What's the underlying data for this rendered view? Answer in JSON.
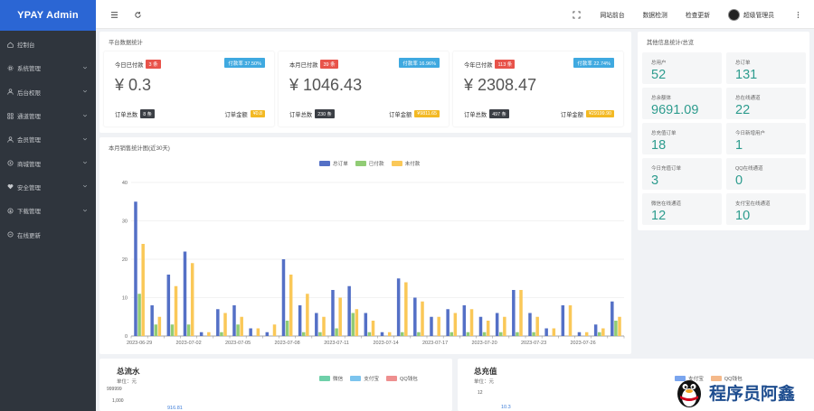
{
  "app": {
    "title": "YPAY Admin"
  },
  "sidebar": {
    "items": [
      {
        "label": "控制台",
        "icon": "home-icon",
        "chevron": false
      },
      {
        "label": "系统管理",
        "icon": "gear-icon",
        "chevron": true
      },
      {
        "label": "后台权限",
        "icon": "user-icon",
        "chevron": true
      },
      {
        "label": "通道管理",
        "icon": "grid-icon",
        "chevron": true
      },
      {
        "label": "会员管理",
        "icon": "user-icon",
        "chevron": true
      },
      {
        "label": "商城管理",
        "icon": "shop-icon",
        "chevron": true
      },
      {
        "label": "安全管理",
        "icon": "heart-icon",
        "chevron": true
      },
      {
        "label": "下载管理",
        "icon": "download-icon",
        "chevron": true
      },
      {
        "label": "在线更新",
        "icon": "refresh-icon",
        "chevron": false
      }
    ]
  },
  "header": {
    "links": [
      "网站前台",
      "数据检测",
      "检查更新"
    ],
    "user": "超级管理员"
  },
  "stats": {
    "title": "平台数据统计",
    "cards": [
      {
        "label": "今日已付款",
        "count_badge": "3 条",
        "rate": "付款率 37.50%",
        "amount": "¥ 0.3",
        "total_orders_label": "订单总数",
        "total_orders": "8 条",
        "total_amount_label": "订单金额",
        "total_amount": "¥0.8"
      },
      {
        "label": "本月已付款",
        "count_badge": "39 条",
        "rate": "付款率 16.96%",
        "amount": "¥ 1046.43",
        "total_orders_label": "订单总数",
        "total_orders": "230 条",
        "total_amount_label": "订单金额",
        "total_amount": "¥9811.65"
      },
      {
        "label": "今年已付款",
        "count_badge": "113 条",
        "rate": "付款率 22.74%",
        "amount": "¥ 2308.47",
        "total_orders_label": "订单总数",
        "total_orders": "497 条",
        "total_amount_label": "订单金额",
        "total_amount": "¥29199.90"
      }
    ]
  },
  "other": {
    "title": "其他信息统计/总览",
    "items": [
      {
        "label": "总用户",
        "value": "52"
      },
      {
        "label": "总订单",
        "value": "131"
      },
      {
        "label": "总余额体",
        "value": "9691.09"
      },
      {
        "label": "总在线通道",
        "value": "22"
      },
      {
        "label": "总充值订单",
        "value": "18"
      },
      {
        "label": "今日新增用户",
        "value": "1"
      },
      {
        "label": "今日充值订单",
        "value": "3"
      },
      {
        "label": "QQ在线通道",
        "value": "0"
      },
      {
        "label": "微信在线通道",
        "value": "12"
      },
      {
        "label": "支付宝在线通道",
        "value": "10"
      }
    ]
  },
  "chart_data": {
    "type": "bar",
    "title": "本月销售统计图(近30天)",
    "series": [
      {
        "name": "总订单",
        "color": "#5470c6",
        "values": [
          35,
          8,
          16,
          22,
          1,
          7,
          8,
          2,
          1,
          20,
          8,
          6,
          12,
          13,
          6,
          1,
          15,
          10,
          5,
          7,
          8,
          5,
          6,
          12,
          6,
          2,
          8,
          1,
          3,
          9
        ]
      },
      {
        "name": "已付款",
        "color": "#91cc75",
        "values": [
          11,
          3,
          3,
          3,
          0,
          1,
          3,
          0,
          0,
          4,
          1,
          1,
          2,
          6,
          1,
          0,
          1,
          1,
          0,
          1,
          1,
          1,
          1,
          1,
          1,
          0,
          0,
          0,
          1,
          4
        ]
      },
      {
        "name": "未付款",
        "color": "#fac858",
        "values": [
          24,
          5,
          13,
          19,
          1,
          6,
          5,
          2,
          3,
          16,
          11,
          5,
          10,
          7,
          4,
          1,
          14,
          9,
          5,
          6,
          7,
          4,
          5,
          12,
          5,
          2,
          8,
          1,
          2,
          5
        ]
      }
    ],
    "x_tick_labels": [
      "2023-06-29",
      "2023-07-02",
      "2023-07-05",
      "2023-07-08",
      "2023-07-11",
      "2023-07-14",
      "2023-07-17",
      "2023-07-20",
      "2023-07-23",
      "2023-07-26"
    ],
    "x_tick_every": 3,
    "y_ticks": [
      0,
      10,
      20,
      30,
      40
    ],
    "ylim": [
      0,
      40
    ],
    "legend_position": "top-center",
    "grid": true
  },
  "flow": {
    "title": "总流水",
    "unit": "单位：元",
    "legend": [
      {
        "name": "微信",
        "color": "#6fd0a9"
      },
      {
        "name": "支付宝",
        "color": "#7cc4ee"
      },
      {
        "name": "QQ钱包",
        "color": "#ee8f8f"
      }
    ],
    "axis_top": "999999",
    "axis_second": "1,000",
    "point_value": "916.81"
  },
  "recharge": {
    "title": "总充值",
    "unit": "单位：元",
    "legend": [
      {
        "name": "支付宝",
        "color": "#7aa5ee"
      },
      {
        "name": "QQ钱包",
        "color": "#f5b98a"
      }
    ],
    "axis_top": "12",
    "point_value": "10.3"
  },
  "watermark": {
    "text": "程序员阿鑫"
  }
}
